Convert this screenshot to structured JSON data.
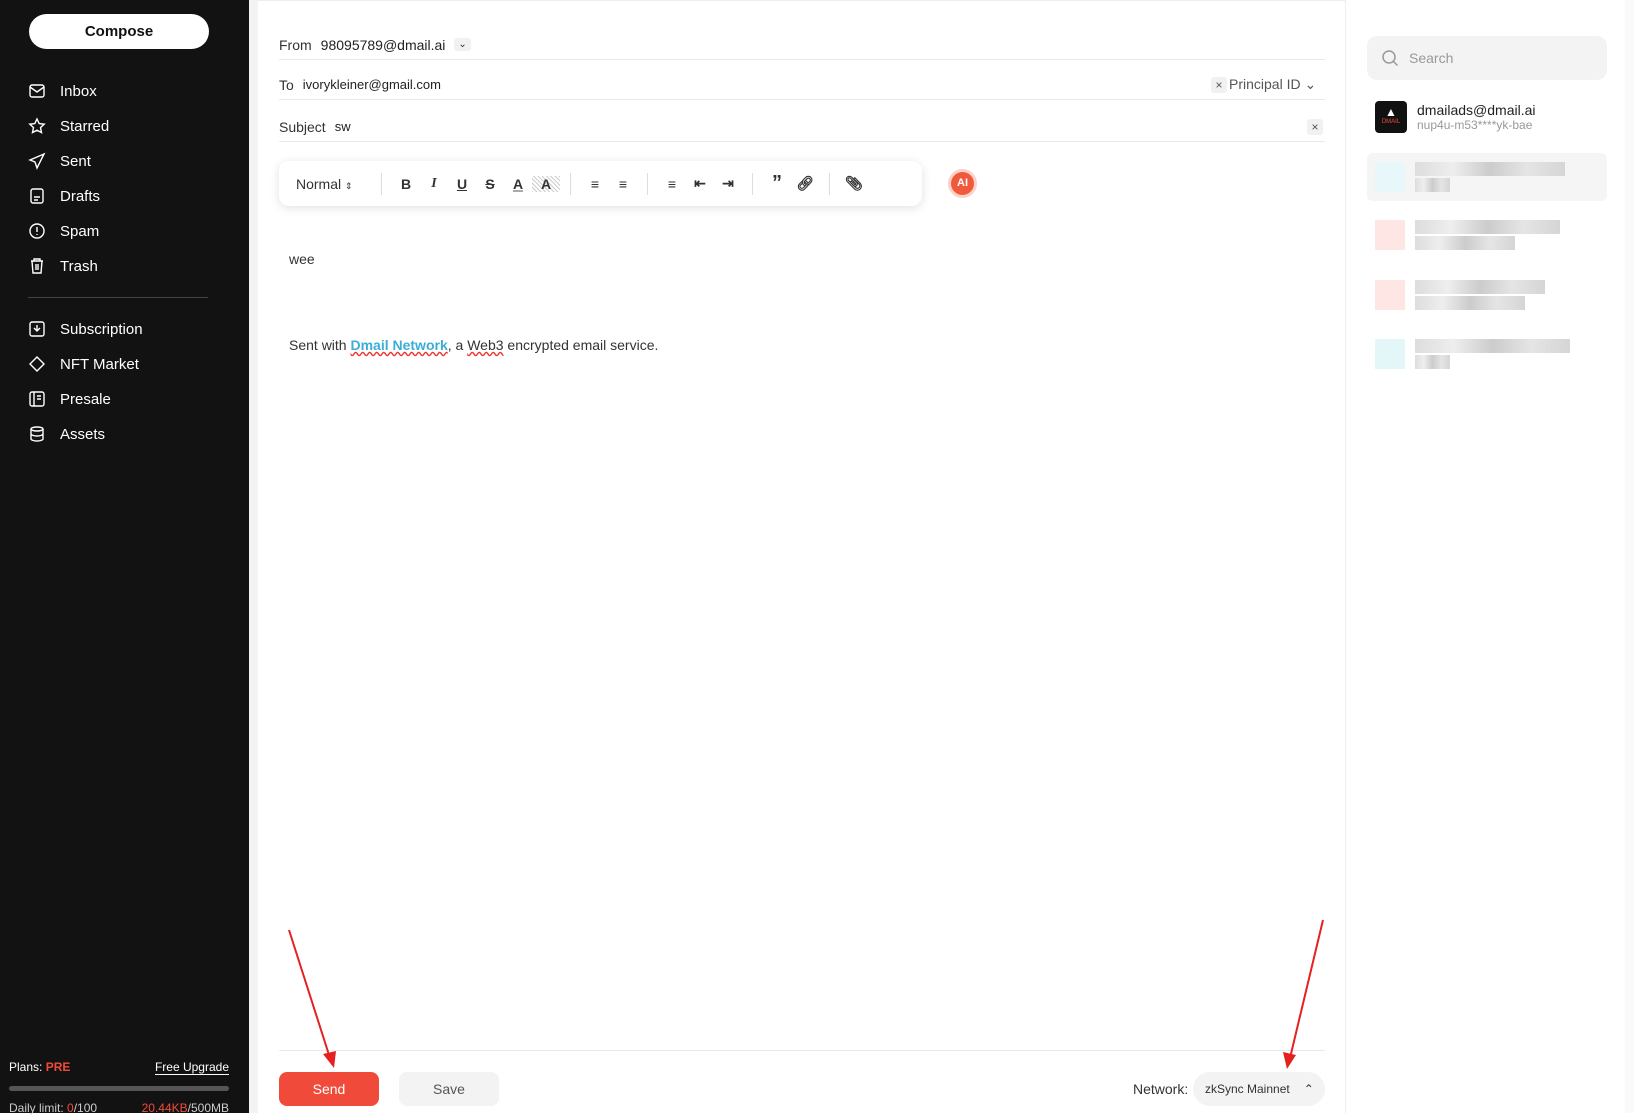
{
  "sidebar": {
    "compose": "Compose",
    "items": [
      {
        "label": "Inbox",
        "icon": "inbox-icon"
      },
      {
        "label": "Starred",
        "icon": "star-icon"
      },
      {
        "label": "Sent",
        "icon": "send-icon"
      },
      {
        "label": "Drafts",
        "icon": "draft-icon"
      },
      {
        "label": "Spam",
        "icon": "spam-icon"
      },
      {
        "label": "Trash",
        "icon": "trash-icon"
      }
    ],
    "items2": [
      {
        "label": "Subscription",
        "icon": "subscription-icon"
      },
      {
        "label": "NFT Market",
        "icon": "puzzle-icon"
      },
      {
        "label": "Presale",
        "icon": "presale-icon"
      },
      {
        "label": "Assets",
        "icon": "database-icon"
      }
    ],
    "plans_label": "Plans:",
    "plan": "PRE",
    "upgrade": "Free Upgrade",
    "daily_label": "Daily limit:",
    "daily_used": "0",
    "daily_total": "/100",
    "storage_used": "20.44KB",
    "storage_total": "/500MB",
    "storage_fraction": 4e-05
  },
  "compose": {
    "from_label": "From",
    "from": "98095789@dmail.ai",
    "to_label": "To",
    "to": "ivorykleiner@gmail.com",
    "principal": "Principal ID",
    "subject_label": "Subject",
    "subject": "sw",
    "format": "Normal",
    "body": "wee",
    "sig_pre": "Sent with ",
    "sig_link": "Dmail Network",
    "sig_mid": ", a ",
    "sig_web3": "Web3",
    "sig_post": " encrypted email service.",
    "ai_label": "AI",
    "send": "Send",
    "save": "Save",
    "network_label": "Network:",
    "network": "zkSync Mainnet"
  },
  "right": {
    "search_placeholder": "Search",
    "contact_email": "dmailads@dmail.ai",
    "contact_id": "nup4u-m53****yk-bae",
    "logo_text": "DMAIL"
  },
  "colors": {
    "accent": "#f04b3a",
    "sidebar": "#121212",
    "link": "#3aaed8"
  }
}
